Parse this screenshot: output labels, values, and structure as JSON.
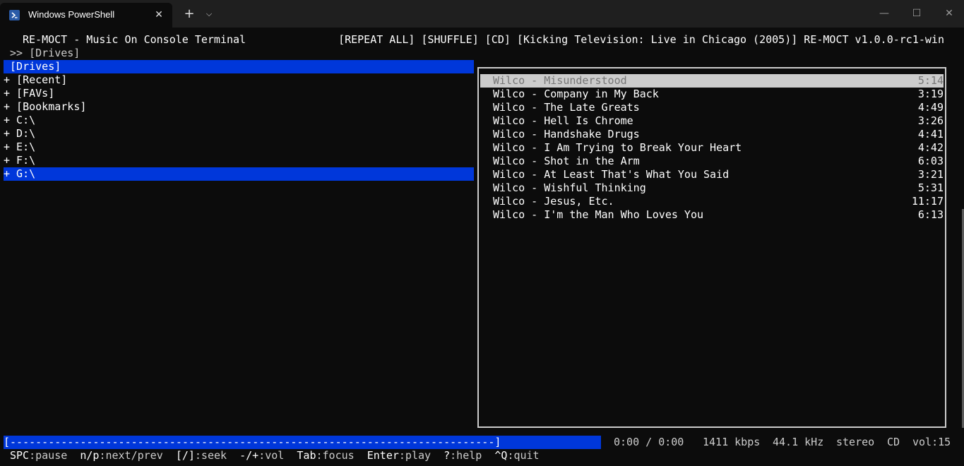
{
  "window": {
    "tab_title": "Windows PowerShell",
    "tab_close_glyph": "✕",
    "new_tab_glyph": "+",
    "dropdown_glyph": "⌵",
    "minimize_glyph": "—",
    "maximize_glyph": "☐",
    "close_glyph": "✕",
    "icon": "powershell-icon"
  },
  "header": {
    "title": "RE-MOCT - Music On Console Terminal",
    "status": "[REPEAT ALL] [SHUFFLE] [CD] [Kicking Television: Live in Chicago (2005)] RE-MOCT v1.0.0-rc1-win"
  },
  "path": ">> [Drives]",
  "tree": [
    {
      "label": " [Drives]",
      "selected": true
    },
    {
      "label": "+ [Recent]",
      "selected": false
    },
    {
      "label": "+ [FAVs]",
      "selected": false
    },
    {
      "label": "+ [Bookmarks]",
      "selected": false
    },
    {
      "label": "+ C:\\",
      "selected": false
    },
    {
      "label": "+ D:\\",
      "selected": false
    },
    {
      "label": "+ E:\\",
      "selected": false
    },
    {
      "label": "+ F:\\",
      "selected": false
    },
    {
      "label": "+ G:\\",
      "selected": true
    }
  ],
  "playlist": [
    {
      "title": "Wilco - Misunderstood",
      "duration": "5:14",
      "active": true
    },
    {
      "title": "Wilco - Company in My Back",
      "duration": "3:19",
      "active": false
    },
    {
      "title": "Wilco - The Late Greats",
      "duration": "4:49",
      "active": false
    },
    {
      "title": "Wilco - Hell Is Chrome",
      "duration": "3:26",
      "active": false
    },
    {
      "title": "Wilco - Handshake Drugs",
      "duration": "4:41",
      "active": false
    },
    {
      "title": "Wilco - I Am Trying to Break Your Heart",
      "duration": "4:42",
      "active": false
    },
    {
      "title": "Wilco - Shot in the Arm",
      "duration": "6:03",
      "active": false
    },
    {
      "title": "Wilco - At Least That's What You Said",
      "duration": "3:21",
      "active": false
    },
    {
      "title": "Wilco - Wishful Thinking",
      "duration": "5:31",
      "active": false
    },
    {
      "title": "Wilco - Jesus, Etc.",
      "duration": "11:17",
      "active": false
    },
    {
      "title": "Wilco - I'm the Man Who Loves You",
      "duration": "6:13",
      "active": false
    }
  ],
  "status_bar": {
    "progress_text": "[----------------------------------------------------------------------------]",
    "time": "0:00 / 0:00",
    "bitrate": "1411 kbps",
    "samplerate": "44.1 kHz",
    "channels": "stereo",
    "source": "CD",
    "volume": "vol:15"
  },
  "footer": [
    {
      "key": "SPC",
      "action": ":pause"
    },
    {
      "key": "n/p",
      "action": ":next/prev"
    },
    {
      "key": "[/]",
      "action": ":seek"
    },
    {
      "key": "-/+",
      "action": ":vol"
    },
    {
      "key": "Tab",
      "action": ":focus"
    },
    {
      "key": "Enter",
      "action": ":play"
    },
    {
      "key": "?",
      "action": ":help"
    },
    {
      "key": "^Q",
      "action": ":quit"
    }
  ],
  "colors": {
    "background": "#0c0c0c",
    "selection": "#0037da",
    "active_track_bg": "#cccccc",
    "text": "#cccccc"
  }
}
